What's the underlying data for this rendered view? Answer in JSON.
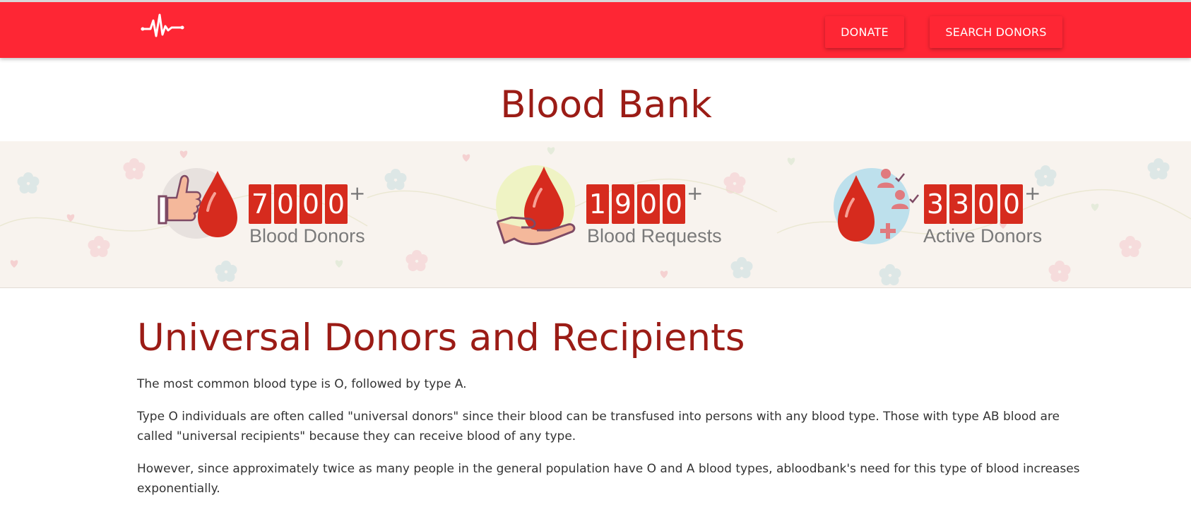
{
  "nav": {
    "logo_icon": "heartbeat-icon",
    "donate_label": "DONATE",
    "search_label": "SEARCH DONORS",
    "brand_color": "#fe2634"
  },
  "page_title": "Blood Bank",
  "stats": [
    {
      "icon": "thumbs-up-blood-drop-icon",
      "digits": [
        "7",
        "0",
        "0",
        "0"
      ],
      "suffix": "+",
      "label": "Blood Donors"
    },
    {
      "icon": "hand-holding-blood-drop-icon",
      "digits": [
        "1",
        "9",
        "0",
        "0"
      ],
      "suffix": "+",
      "label": "Blood Requests"
    },
    {
      "icon": "blood-drop-users-icon",
      "digits": [
        "3",
        "3",
        "0",
        "0"
      ],
      "suffix": "+",
      "label": "Active Donors"
    }
  ],
  "section": {
    "heading": "Universal Donors and Recipients",
    "paragraphs": [
      "The most common blood type is O, followed by type A.",
      "Type O individuals are often called \"universal donors\" since their blood can be transfused into persons with any blood type. Those with type AB blood are called \"universal recipients\" because they can receive blood of any type.",
      "However, since approximately twice as many people in the general population have O and A blood types, abloodbank's need for this type of blood increases exponentially."
    ]
  },
  "colors": {
    "heading": "#9b1c16",
    "digit_bg": "#d62b1e",
    "band_bg": "#f8f3ee"
  }
}
